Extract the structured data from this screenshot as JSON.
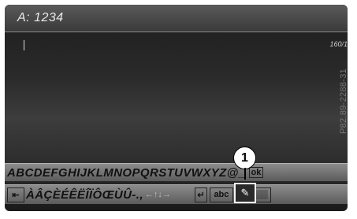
{
  "header": {
    "address": "A: 1234"
  },
  "text_area": {
    "char_counter": "160/1"
  },
  "keyboard": {
    "row1_chars": "ABCDEFGHIJKLMNOPQRSTUVWXYZ@_",
    "row1_ok": "ok",
    "row2_chars": "ÀÂÇÈÉÊËÎÏÔŒÙÛ-.,",
    "row2_arrows": "←↑↓→",
    "enter_glyph": "↵",
    "abc_label": "abc",
    "more_label": "...",
    "extra_label": "▒▒"
  },
  "callout": {
    "number": "1"
  },
  "figure_code": "P82.89-2288-31"
}
